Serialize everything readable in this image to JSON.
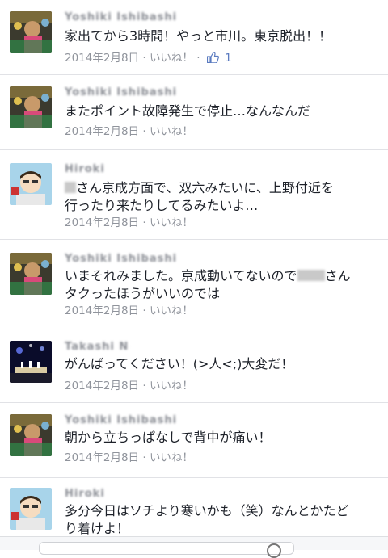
{
  "comments": [
    {
      "name": "Yoshiki Ishibashi",
      "text": "家出てから3時間！やっと市川。東京脱出！！",
      "date": "2014年2月8日",
      "like_label": "いいね！",
      "like_count": "1",
      "avatar": "photo-crowd-icon"
    },
    {
      "name": "Yoshiki Ishibashi",
      "text": "またポイント故障発生で停止…なんなんだ",
      "date": "2014年2月8日",
      "like_label": "いいね！",
      "avatar": "photo-crowd-icon"
    },
    {
      "name": "Hiroki Ito",
      "text_line1": "さん京成方面で、双六みたいに、上野付近を",
      "text_line2": "行ったり来たりしてるみたいよ…",
      "date": "2014年2月8日",
      "like_label": "いいね！",
      "avatar": "cartoon-avatar-icon"
    },
    {
      "name": "Yoshiki Ishibashi",
      "text_line1a": "いまそれみました。京成動いてないので",
      "text_line1b": "さん",
      "text_line2": "タクったほうがいいのでは",
      "date": "2014年2月8日",
      "like_label": "いいね！",
      "avatar": "photo-crowd-icon"
    },
    {
      "name": "Takashi Noguchi",
      "text": "がんばってください！(>人<;)大変だ！",
      "date": "2014年2月8日",
      "like_label": "いいね！",
      "avatar": "stage-night-icon"
    },
    {
      "name": "Yoshiki Ishibashi",
      "text": "朝から立ちっぱなしで背中が痛い！",
      "date": "2014年2月8日",
      "like_label": "いいね！",
      "avatar": "photo-crowd-icon"
    },
    {
      "name": "Hiroki Ito",
      "text_line1": "多分今日はソチより寒いかも（笑）なんとかたど",
      "text_line2": "り着けよ！",
      "avatar": "cartoon-avatar-icon"
    }
  ]
}
